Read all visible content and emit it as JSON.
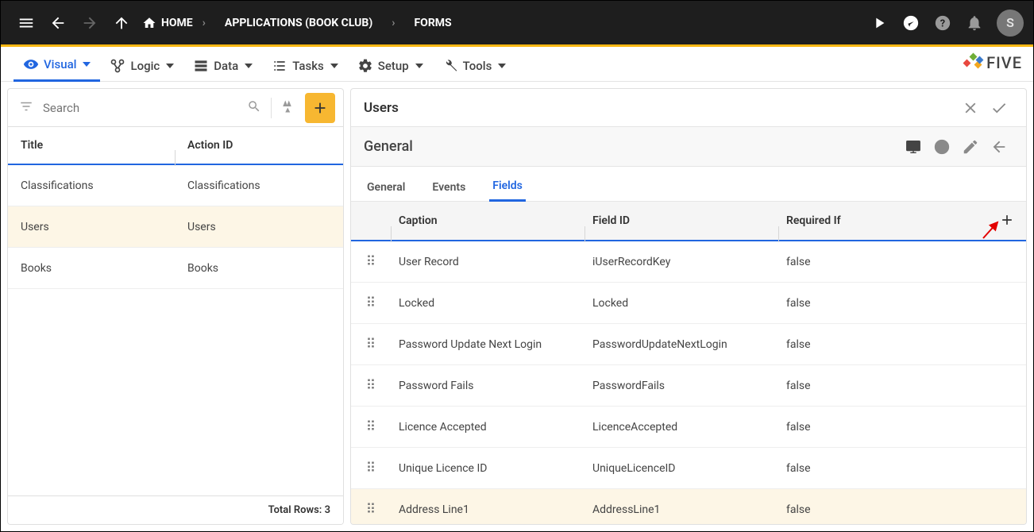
{
  "topbar": {
    "breadcrumb": {
      "home": "HOME",
      "app": "APPLICATIONS (BOOK CLUB)",
      "page": "FORMS"
    },
    "avatar_initial": "S"
  },
  "menubar": {
    "visual": "Visual",
    "logic": "Logic",
    "data": "Data",
    "tasks": "Tasks",
    "setup": "Setup",
    "tools": "Tools",
    "brand": "FIVE"
  },
  "search": {
    "placeholder": "Search"
  },
  "left": {
    "headers": {
      "title": "Title",
      "action_id": "Action ID"
    },
    "rows": [
      {
        "title": "Classifications",
        "action_id": "Classifications",
        "selected": false
      },
      {
        "title": "Users",
        "action_id": "Users",
        "selected": true
      },
      {
        "title": "Books",
        "action_id": "Books",
        "selected": false
      }
    ],
    "footer_label": "Total Rows:",
    "footer_count": "3"
  },
  "right": {
    "title": "Users",
    "subtitle": "General",
    "tabs": {
      "general": "General",
      "events": "Events",
      "fields": "Fields"
    },
    "field_headers": {
      "caption": "Caption",
      "field_id": "Field ID",
      "required_if": "Required If"
    },
    "fields": [
      {
        "caption": "User Record",
        "field_id": "iUserRecordKey",
        "required_if": "false"
      },
      {
        "caption": "Locked",
        "field_id": "Locked",
        "required_if": "false"
      },
      {
        "caption": "Password Update Next Login",
        "field_id": "PasswordUpdateNextLogin",
        "required_if": "false"
      },
      {
        "caption": "Password Fails",
        "field_id": "PasswordFails",
        "required_if": "false"
      },
      {
        "caption": "Licence Accepted",
        "field_id": "LicenceAccepted",
        "required_if": "false"
      },
      {
        "caption": "Unique Licence ID",
        "field_id": "UniqueLicenceID",
        "required_if": "false"
      },
      {
        "caption": "Address Line1",
        "field_id": "AddressLine1",
        "required_if": "false"
      }
    ]
  }
}
